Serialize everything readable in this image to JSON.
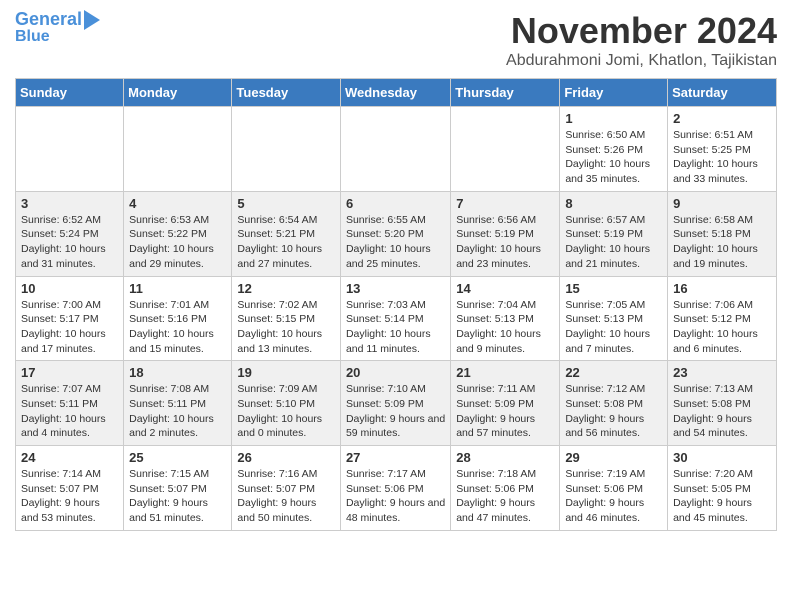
{
  "header": {
    "logo_line1": "General",
    "logo_line2": "Blue",
    "month": "November 2024",
    "location": "Abdurahmoni Jomi, Khatlon, Tajikistan"
  },
  "days_of_week": [
    "Sunday",
    "Monday",
    "Tuesday",
    "Wednesday",
    "Thursday",
    "Friday",
    "Saturday"
  ],
  "weeks": [
    [
      {
        "day": "",
        "info": ""
      },
      {
        "day": "",
        "info": ""
      },
      {
        "day": "",
        "info": ""
      },
      {
        "day": "",
        "info": ""
      },
      {
        "day": "",
        "info": ""
      },
      {
        "day": "1",
        "info": "Sunrise: 6:50 AM\nSunset: 5:26 PM\nDaylight: 10 hours and 35 minutes."
      },
      {
        "day": "2",
        "info": "Sunrise: 6:51 AM\nSunset: 5:25 PM\nDaylight: 10 hours and 33 minutes."
      }
    ],
    [
      {
        "day": "3",
        "info": "Sunrise: 6:52 AM\nSunset: 5:24 PM\nDaylight: 10 hours and 31 minutes."
      },
      {
        "day": "4",
        "info": "Sunrise: 6:53 AM\nSunset: 5:22 PM\nDaylight: 10 hours and 29 minutes."
      },
      {
        "day": "5",
        "info": "Sunrise: 6:54 AM\nSunset: 5:21 PM\nDaylight: 10 hours and 27 minutes."
      },
      {
        "day": "6",
        "info": "Sunrise: 6:55 AM\nSunset: 5:20 PM\nDaylight: 10 hours and 25 minutes."
      },
      {
        "day": "7",
        "info": "Sunrise: 6:56 AM\nSunset: 5:19 PM\nDaylight: 10 hours and 23 minutes."
      },
      {
        "day": "8",
        "info": "Sunrise: 6:57 AM\nSunset: 5:19 PM\nDaylight: 10 hours and 21 minutes."
      },
      {
        "day": "9",
        "info": "Sunrise: 6:58 AM\nSunset: 5:18 PM\nDaylight: 10 hours and 19 minutes."
      }
    ],
    [
      {
        "day": "10",
        "info": "Sunrise: 7:00 AM\nSunset: 5:17 PM\nDaylight: 10 hours and 17 minutes."
      },
      {
        "day": "11",
        "info": "Sunrise: 7:01 AM\nSunset: 5:16 PM\nDaylight: 10 hours and 15 minutes."
      },
      {
        "day": "12",
        "info": "Sunrise: 7:02 AM\nSunset: 5:15 PM\nDaylight: 10 hours and 13 minutes."
      },
      {
        "day": "13",
        "info": "Sunrise: 7:03 AM\nSunset: 5:14 PM\nDaylight: 10 hours and 11 minutes."
      },
      {
        "day": "14",
        "info": "Sunrise: 7:04 AM\nSunset: 5:13 PM\nDaylight: 10 hours and 9 minutes."
      },
      {
        "day": "15",
        "info": "Sunrise: 7:05 AM\nSunset: 5:13 PM\nDaylight: 10 hours and 7 minutes."
      },
      {
        "day": "16",
        "info": "Sunrise: 7:06 AM\nSunset: 5:12 PM\nDaylight: 10 hours and 6 minutes."
      }
    ],
    [
      {
        "day": "17",
        "info": "Sunrise: 7:07 AM\nSunset: 5:11 PM\nDaylight: 10 hours and 4 minutes."
      },
      {
        "day": "18",
        "info": "Sunrise: 7:08 AM\nSunset: 5:11 PM\nDaylight: 10 hours and 2 minutes."
      },
      {
        "day": "19",
        "info": "Sunrise: 7:09 AM\nSunset: 5:10 PM\nDaylight: 10 hours and 0 minutes."
      },
      {
        "day": "20",
        "info": "Sunrise: 7:10 AM\nSunset: 5:09 PM\nDaylight: 9 hours and 59 minutes."
      },
      {
        "day": "21",
        "info": "Sunrise: 7:11 AM\nSunset: 5:09 PM\nDaylight: 9 hours and 57 minutes."
      },
      {
        "day": "22",
        "info": "Sunrise: 7:12 AM\nSunset: 5:08 PM\nDaylight: 9 hours and 56 minutes."
      },
      {
        "day": "23",
        "info": "Sunrise: 7:13 AM\nSunset: 5:08 PM\nDaylight: 9 hours and 54 minutes."
      }
    ],
    [
      {
        "day": "24",
        "info": "Sunrise: 7:14 AM\nSunset: 5:07 PM\nDaylight: 9 hours and 53 minutes."
      },
      {
        "day": "25",
        "info": "Sunrise: 7:15 AM\nSunset: 5:07 PM\nDaylight: 9 hours and 51 minutes."
      },
      {
        "day": "26",
        "info": "Sunrise: 7:16 AM\nSunset: 5:07 PM\nDaylight: 9 hours and 50 minutes."
      },
      {
        "day": "27",
        "info": "Sunrise: 7:17 AM\nSunset: 5:06 PM\nDaylight: 9 hours and 48 minutes."
      },
      {
        "day": "28",
        "info": "Sunrise: 7:18 AM\nSunset: 5:06 PM\nDaylight: 9 hours and 47 minutes."
      },
      {
        "day": "29",
        "info": "Sunrise: 7:19 AM\nSunset: 5:06 PM\nDaylight: 9 hours and 46 minutes."
      },
      {
        "day": "30",
        "info": "Sunrise: 7:20 AM\nSunset: 5:05 PM\nDaylight: 9 hours and 45 minutes."
      }
    ]
  ]
}
